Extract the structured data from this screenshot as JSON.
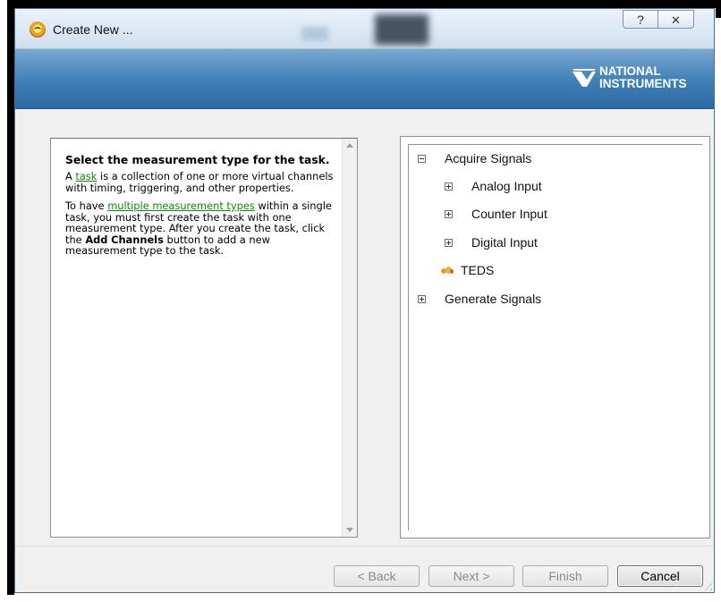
{
  "window": {
    "title": "Create New ...",
    "help_glyph": "?",
    "close_glyph": "✕",
    "icon": "ni-max-icon"
  },
  "banner": {
    "logo_line1": "NATIONAL",
    "logo_line2": "INSTRUMENTS",
    "color": "#3f7fb6"
  },
  "info": {
    "heading": "Select the measurement type for the task.",
    "p1_prefix": "A ",
    "p1_link": "task",
    "p1_suffix": " is a collection of one or more virtual channels with timing, triggering, and other properties.",
    "p2_prefix": "To have ",
    "p2_link": "multiple measurement types",
    "p2_mid": " within a single task, you must first create the task with one measurement type. After you create the task, click the ",
    "p2_bold1": "Add",
    "p2_bold2": "Channels",
    "p2_suffix": " button to add a new measurement type to the task.",
    "link_color": "#138913"
  },
  "tree": {
    "root": "Acquire Signals",
    "children": [
      "Analog Input",
      "Counter Input",
      "Digital Input",
      "TEDS"
    ],
    "sibling": "Generate Signals"
  },
  "buttons": {
    "back": "< Back",
    "next": "Next >",
    "finish": "Finish",
    "cancel": "Cancel"
  }
}
